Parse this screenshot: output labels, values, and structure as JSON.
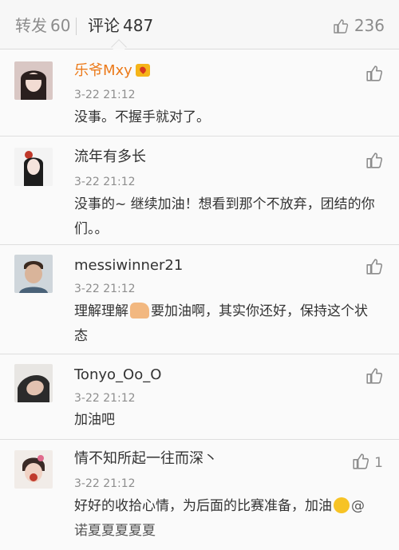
{
  "tabs": {
    "repost_label": "转发",
    "repost_count": "60",
    "comments_label": "评论",
    "comments_count": "487",
    "likes_count": "236"
  },
  "comments": [
    {
      "username": "乐爷Mxy",
      "time": "3-22 21:12",
      "text": "没事。不握手就对了。",
      "likes": ""
    },
    {
      "username": "流年有多长",
      "time": "3-22 21:12",
      "text": "没事的~ 继续加油！想看到那个不放弃，团结的你们。。",
      "likes": ""
    },
    {
      "username": "messiwinner21",
      "time": "3-22 21:12",
      "text_before": "理解理解",
      "emoji": "thumbs-up-emoji",
      "text_after": "要加油啊，其实你还好，保持这个状态",
      "likes": ""
    },
    {
      "username": "Tonyo_Oo_O",
      "time": "3-22 21:12",
      "text": "加油吧",
      "likes": ""
    },
    {
      "username": "情不知所起一往而深丶",
      "time": "3-22 21:12",
      "text_before": "好好的收拾心情，为后面的比赛准备，加油",
      "emoji": "crying-emoji",
      "mention": "@诺夏夏夏夏夏",
      "likes": "1"
    }
  ],
  "colors": {
    "vip_name": "#ec7a1a",
    "text": "#333333",
    "meta": "#8e8e8e",
    "divider": "#dedede"
  }
}
